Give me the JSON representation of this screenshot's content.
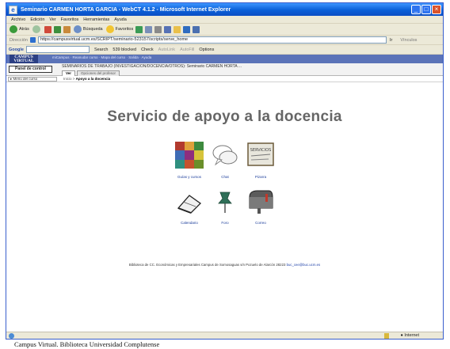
{
  "window": {
    "title": "Seminario CARMEN HORTA GARCIA - WebCT 4.1.2 - Microsoft Internet Explorer",
    "minimize": "_",
    "maximize": "□",
    "close": "×"
  },
  "menubar": [
    "Archivo",
    "Edición",
    "Ver",
    "Favoritos",
    "Herramientas",
    "Ayuda"
  ],
  "toolbar": {
    "back": "Atrás",
    "search": "Búsqueda",
    "favorites": "Favoritos"
  },
  "addressbar": {
    "label": "Dirección",
    "url": "https://campusvirtual.ucm.es/SCRIPT/seminario-523157/scripts/serve_home",
    "go": "Ir",
    "links": "Vínculos"
  },
  "googlebar": {
    "brand": "Google",
    "search": "Search",
    "blocked": "539 blocked",
    "check": "Check",
    "autolink": "AutoLink",
    "autofill": "AutoFill",
    "options": "Options"
  },
  "campus": {
    "logo_line1": "CAMPUS",
    "logo_line2": "VIRTUAL",
    "nav_links": "miCampus · Reanudar curso · Mapa del curso · Salida · Ayuda",
    "panel_button": "Panel de control",
    "course_title": "SEMINARIOS DE TRABAJO (INVESTIGACION/DOCENCIA/OTROS): Seminario CARMEN HORTA ...",
    "tab_view": "Ver",
    "tab_designer": "Opciones del profesor",
    "course_menu": "Menú del curso",
    "breadcrumb_home": "Inicio",
    "breadcrumb_current": "Apoyo a la docencia"
  },
  "page": {
    "title": "Servicio de apoyo a la docencia",
    "tiles": [
      {
        "label": "Guías y cursos"
      },
      {
        "label": "Chat"
      },
      {
        "label": "Pizarra"
      },
      {
        "label": "Calendario"
      },
      {
        "label": "Foro"
      },
      {
        "label": "Correo"
      }
    ],
    "pizarra_board_text": "SERVICIOS",
    "footer_prefix": "Biblioteca de CC. Económicas y Empresariales Campus de Somosaguas s/n Pozuelo de Alarcón 28223",
    "footer_email": "buc_cee@buc.ucm.es"
  },
  "statusbar": {
    "zone": "Internet"
  },
  "caption": "Campus  Virtual. Biblioteca Universidad Complutense"
}
